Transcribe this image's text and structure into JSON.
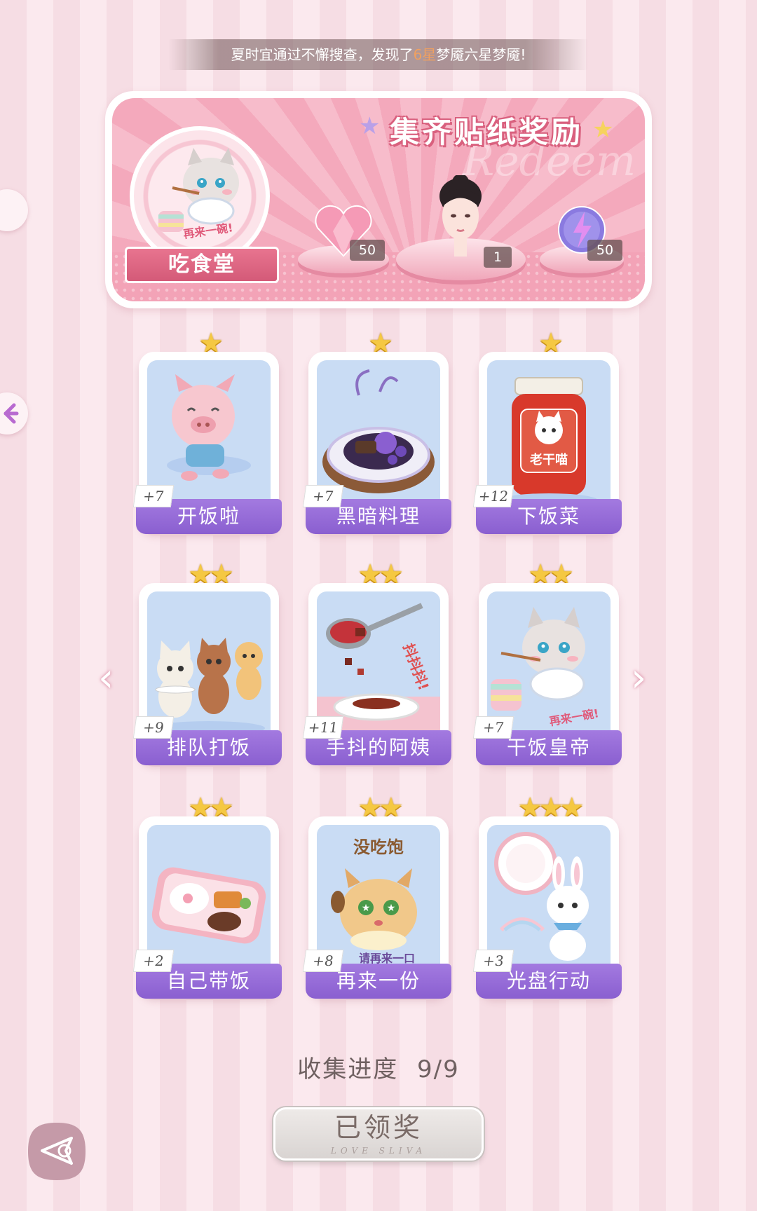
{
  "notice": {
    "prefix": "夏时宜通过不懈搜查，发现了",
    "highlight": "6星",
    "suffix": "梦魇六星梦魇!"
  },
  "reward": {
    "title": "集齐贴纸奖励",
    "watermark": "Redeem",
    "badge_label": "吃食堂",
    "badge_caption": "再来一碗!",
    "items": [
      {
        "name": "heart-gem",
        "count": "50"
      },
      {
        "name": "avatar-head",
        "count": "1"
      },
      {
        "name": "energy-orb",
        "count": "50"
      }
    ]
  },
  "cards": [
    {
      "label": "开饭啦",
      "count": "+7",
      "stars": "★",
      "icon": "pig"
    },
    {
      "label": "黑暗料理",
      "count": "+7",
      "stars": "★",
      "icon": "dark-dish"
    },
    {
      "label": "下饭菜",
      "count": "+12",
      "stars": "★",
      "icon": "chili-jar",
      "jar_text": "老干喵"
    },
    {
      "label": "排队打饭",
      "count": "+9",
      "stars": "★★",
      "icon": "queue-animals"
    },
    {
      "label": "手抖的阿姨",
      "count": "+11",
      "stars": "★★",
      "icon": "ladle",
      "caption": "抖抖抖!"
    },
    {
      "label": "干饭皇帝",
      "count": "+7",
      "stars": "★★",
      "icon": "rice-cat",
      "caption": "再来一碗!"
    },
    {
      "label": "自己带饭",
      "count": "+2",
      "stars": "★★",
      "icon": "bento"
    },
    {
      "label": "再来一份",
      "count": "+8",
      "stars": "★★",
      "icon": "hungry-hamster",
      "caption_top": "没吃饱",
      "caption_bottom": "请再来一口"
    },
    {
      "label": "光盘行动",
      "count": "+3",
      "stars": "★★★",
      "icon": "bunny-plate"
    }
  ],
  "progress": {
    "label": "收集进度",
    "value": "9/9"
  },
  "claim": {
    "label": "已领奖",
    "sub": "LOVE SLIVA"
  },
  "colors": {
    "accent": "#8a5fd0",
    "pink": "#f3a3b7",
    "star": "#f5c842"
  }
}
